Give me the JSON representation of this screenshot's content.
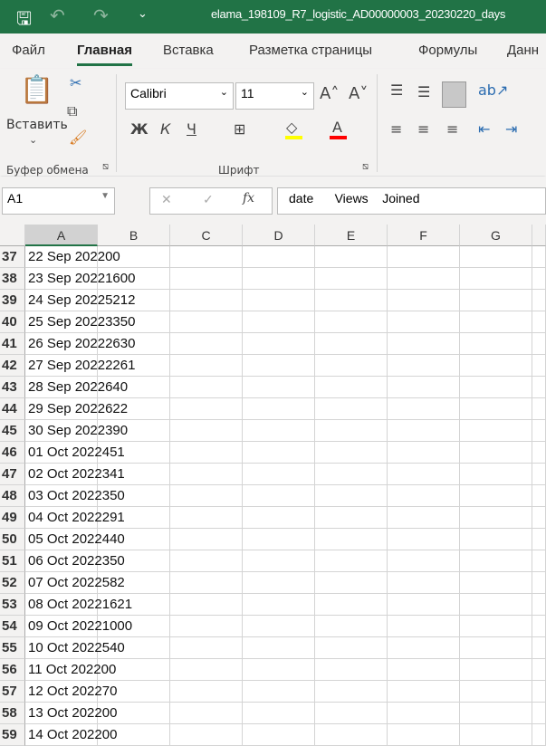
{
  "title": "elama_198109_R7_logistic_AD00000003_20230220_days",
  "tabs": [
    "Файл",
    "Главная",
    "Вставка",
    "Разметка страницы",
    "Формулы",
    "Данн"
  ],
  "ribbon": {
    "paste": "Вставить",
    "clipboard_group": "Буфер обмена",
    "font_group": "Шрифт",
    "font_name": "Calibri",
    "font_size": "11",
    "bold": "Ж",
    "italic": "К",
    "underline": "Ч"
  },
  "formula": {
    "name_box": "A1",
    "fx": "fx",
    "content": "date      Views    Joined"
  },
  "colors": {
    "accent": "#217346",
    "highlight": "#ffff00",
    "font_color": "#ff0000"
  },
  "columns": [
    "A",
    "B",
    "C",
    "D",
    "E",
    "F",
    "G"
  ],
  "rows": [
    {
      "n": "37",
      "a": "22 Sep 202200"
    },
    {
      "n": "38",
      "a": "23 Sep 20221600"
    },
    {
      "n": "39",
      "a": "24 Sep 20225212"
    },
    {
      "n": "40",
      "a": "25 Sep 20223350"
    },
    {
      "n": "41",
      "a": "26 Sep 20222630"
    },
    {
      "n": "42",
      "a": "27 Sep 20222261"
    },
    {
      "n": "43",
      "a": "28 Sep 2022640"
    },
    {
      "n": "44",
      "a": "29 Sep 2022622"
    },
    {
      "n": "45",
      "a": "30 Sep 2022390"
    },
    {
      "n": "46",
      "a": "01 Oct 2022451"
    },
    {
      "n": "47",
      "a": "02 Oct 2022341"
    },
    {
      "n": "48",
      "a": "03 Oct 2022350"
    },
    {
      "n": "49",
      "a": "04 Oct 2022291"
    },
    {
      "n": "50",
      "a": "05 Oct 2022440"
    },
    {
      "n": "51",
      "a": "06 Oct 2022350"
    },
    {
      "n": "52",
      "a": "07 Oct 2022582"
    },
    {
      "n": "53",
      "a": "08 Oct 20221621"
    },
    {
      "n": "54",
      "a": "09 Oct 20221000"
    },
    {
      "n": "55",
      "a": "10 Oct 2022540"
    },
    {
      "n": "56",
      "a": "11 Oct 202200"
    },
    {
      "n": "57",
      "a": "12 Oct 202270"
    },
    {
      "n": "58",
      "a": "13 Oct 202200"
    },
    {
      "n": "59",
      "a": "14 Oct 202200"
    }
  ]
}
